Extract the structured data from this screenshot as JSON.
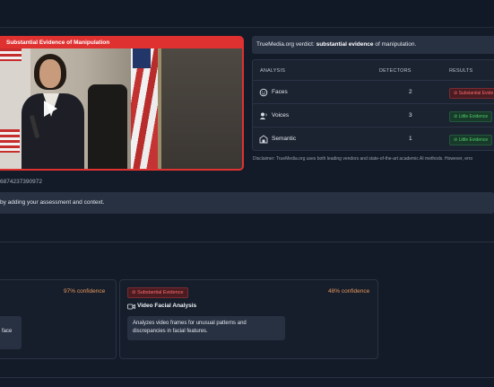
{
  "video": {
    "banner": "Substantial Evidence of Manipulation",
    "hash_suffix": "6874237390972"
  },
  "context_prompt": "by adding your assessment and context.",
  "verdict": {
    "prefix": "TrueMedia.org verdict: ",
    "strong": "substantial evidence",
    "suffix": " of manipulation."
  },
  "table": {
    "headers": {
      "analysis": "ANALYSIS",
      "detectors": "DETECTORS",
      "results": "RESULTS"
    },
    "rows": [
      {
        "icon": "face-icon",
        "label": "Faces",
        "detectors": "2",
        "result": "Substantial Evide",
        "result_color": "#ff6b6b"
      },
      {
        "icon": "voice-icon",
        "label": "Voices",
        "detectors": "3",
        "result": "Little Evidence",
        "result_color": "#51cf66"
      },
      {
        "icon": "semantic-icon",
        "label": "Semantic",
        "detectors": "1",
        "result": "Little Evidence",
        "result_color": "#51cf66"
      }
    ]
  },
  "disclaimer": "Disclaimer: TrueMedia.org uses both leading vendors and state-of-the-art academic AI methods. However, erro",
  "cards": {
    "left": {
      "confidence": "97% confidence",
      "desc_partial": "face"
    },
    "right": {
      "badge": "Substantial Evidence",
      "confidence": "48% confidence",
      "title": "Video Facial Analysis",
      "description": "Analyzes video frames for unusual patterns and discrepancies in facial features."
    }
  },
  "colors": {
    "danger": "#e03131",
    "success": "#51cf66",
    "confidence": "#e8965c"
  }
}
